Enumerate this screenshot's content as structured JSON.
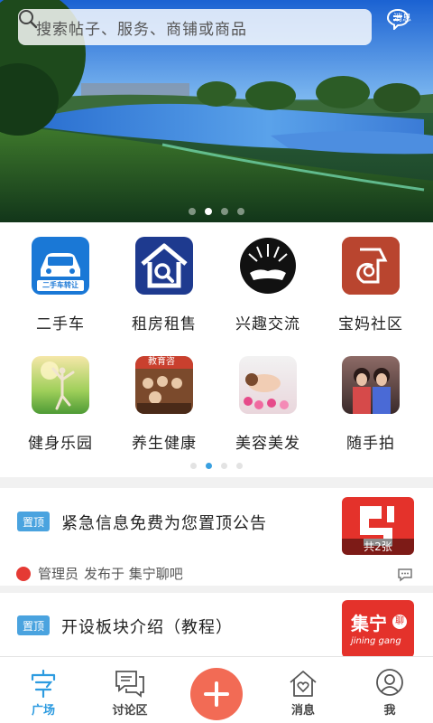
{
  "search": {
    "placeholder": "搜索帖子、服务、商铺或商品"
  },
  "header": {
    "message_label": "消息"
  },
  "banner": {
    "slide_count": 4,
    "active_slide": 2
  },
  "categories": [
    {
      "label": "二手车",
      "icon": "used-car-icon",
      "icon_text": "二手车转让"
    },
    {
      "label": "租房租售",
      "icon": "house-search-icon"
    },
    {
      "label": "兴趣交流",
      "icon": "handshake-icon"
    },
    {
      "label": "宝妈社区",
      "icon": "mom-baby-icon"
    },
    {
      "label": "健身乐园",
      "icon": "yoga-photo-icon"
    },
    {
      "label": "养生健康",
      "icon": "health-class-photo-icon",
      "icon_text": "教育咨"
    },
    {
      "label": "美容美发",
      "icon": "spa-photo-icon"
    },
    {
      "label": "随手拍",
      "icon": "snapshot-photo-icon"
    }
  ],
  "grid_pager": {
    "page_count": 4,
    "active_page": 2
  },
  "posts": [
    {
      "tag": "置顶",
      "title": "紧急信息免费为您置顶公告",
      "thumb_caption": "共2张",
      "author_role": "管理员",
      "published_in": "发布于 集宁聊吧"
    },
    {
      "tag": "置顶",
      "title": "开设板块介绍（教程）",
      "thumb_text": "集宁",
      "thumb_badge": "聊",
      "thumb_subtext": "jining gang"
    }
  ],
  "nav": [
    {
      "label": "广场",
      "icon": "plaza-icon",
      "active": true
    },
    {
      "label": "讨论区",
      "icon": "chat-bubbles-icon",
      "active": false
    },
    {
      "label": "",
      "icon": "plus-icon",
      "active": false
    },
    {
      "label": "消息",
      "icon": "home-heart-icon",
      "active": false
    },
    {
      "label": "我",
      "icon": "user-icon",
      "active": false
    }
  ],
  "colors": {
    "accent": "#2d9be0",
    "tag": "#4aa3df",
    "publish": "#f26b55"
  }
}
